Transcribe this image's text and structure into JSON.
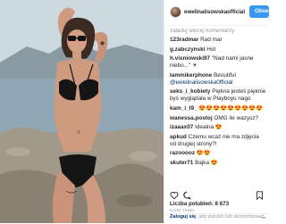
{
  "header": {
    "username": "ewelinalisowskaofficial",
    "follow_label": "Obserwuj"
  },
  "comments_section": {
    "load_more": "załaduj więcej komentarzy",
    "items": [
      {
        "user": "123radmar",
        "text": " Rad mar"
      },
      {
        "user": "g.zabczynski",
        "text": " Hot"
      },
      {
        "user": "h.visniowski97",
        "text": " \"Nad nami jasne niebo...\" ☀"
      },
      {
        "user": "lammikerphone",
        "text": " Beoutiful ",
        "mention": "@ewelinalisowska0fficial"
      },
      {
        "user": "seks_i_kobiety",
        "text": " Piękna jesteś pięknie byś wyglądała w Playboyu nago"
      },
      {
        "user": "kam_i_I9_",
        "text": " 😍😍😍😍😍😍😍😍😍"
      },
      {
        "user": "wanessa.postoj",
        "text": " OMG ile wazysz?"
      },
      {
        "user": "izaaax07",
        "text": " Idealna 😍"
      },
      {
        "user": "apkud",
        "text": " Czemu wcaż nie ma zdjęcia od drugiej strony?!"
      },
      {
        "user": "razooooz",
        "text": " 😍😍"
      },
      {
        "user": "skuter71",
        "text": " Bajka 😍"
      }
    ]
  },
  "actions": {
    "like_icon": "heart-icon",
    "comment_icon": "comment-icon",
    "save_icon": "bookmark-icon"
  },
  "likes_text": "Liczba polubień: 8 673",
  "date_text": "3 DNI TEMU",
  "footer": {
    "login_label": "Zaloguj się",
    "suffix": ", aby polubić lub skomentować.",
    "more_label": "···"
  },
  "photo": {
    "alt_subject": "woman-in-black-bikini-on-rocky-beach",
    "colors": {
      "sky": "#c4d3dc",
      "sea": "#8fa6b4",
      "rock": "#9a8f82",
      "bikini": "#151515",
      "skin": "#cf9b80"
    }
  }
}
